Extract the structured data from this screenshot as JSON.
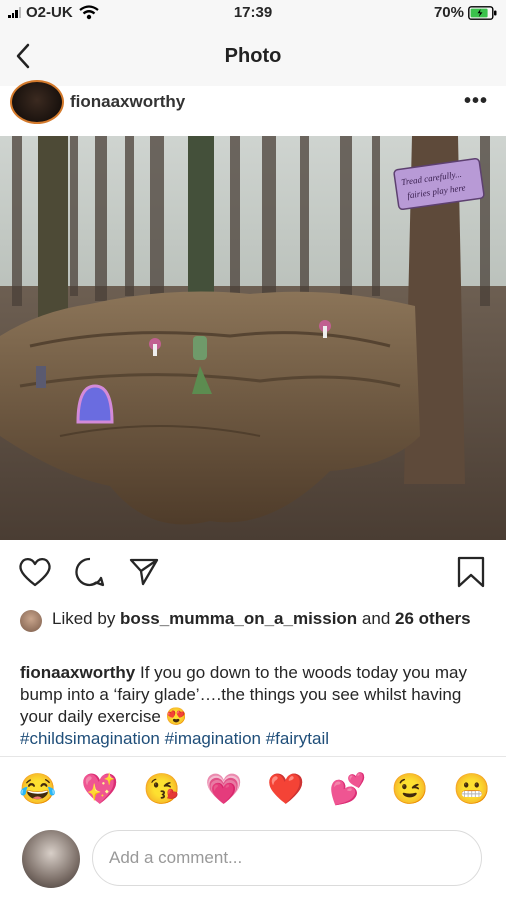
{
  "status_bar": {
    "carrier": "O2-UK",
    "time": "17:39",
    "battery": "70%"
  },
  "nav": {
    "title": "Photo"
  },
  "post": {
    "username": "fionaaxworthy",
    "more": "•••",
    "photo_sign_text": "Tread carefully... fairies play here"
  },
  "likes": {
    "prefix": "Liked by ",
    "liker": "boss_mumma_on_a_mission",
    "middle": " and ",
    "others": "26 others"
  },
  "caption": {
    "username": "fionaaxworthy",
    "text": " If you go down to the woods today you may bump into a ‘fairy glade’….the things you see whilst having your daily exercise 😍",
    "hashtags": "#childsimagination #imagination #fairytail"
  },
  "reactions": [
    "😂",
    "💖",
    "😘",
    "💗",
    "❤️",
    "💕",
    "😉",
    "😬"
  ],
  "comment": {
    "placeholder": "Add a comment..."
  },
  "icons": [
    "back-icon",
    "more-icon",
    "heart-icon",
    "comment-icon",
    "share-icon",
    "bookmark-icon",
    "wifi-icon",
    "battery-icon"
  ]
}
